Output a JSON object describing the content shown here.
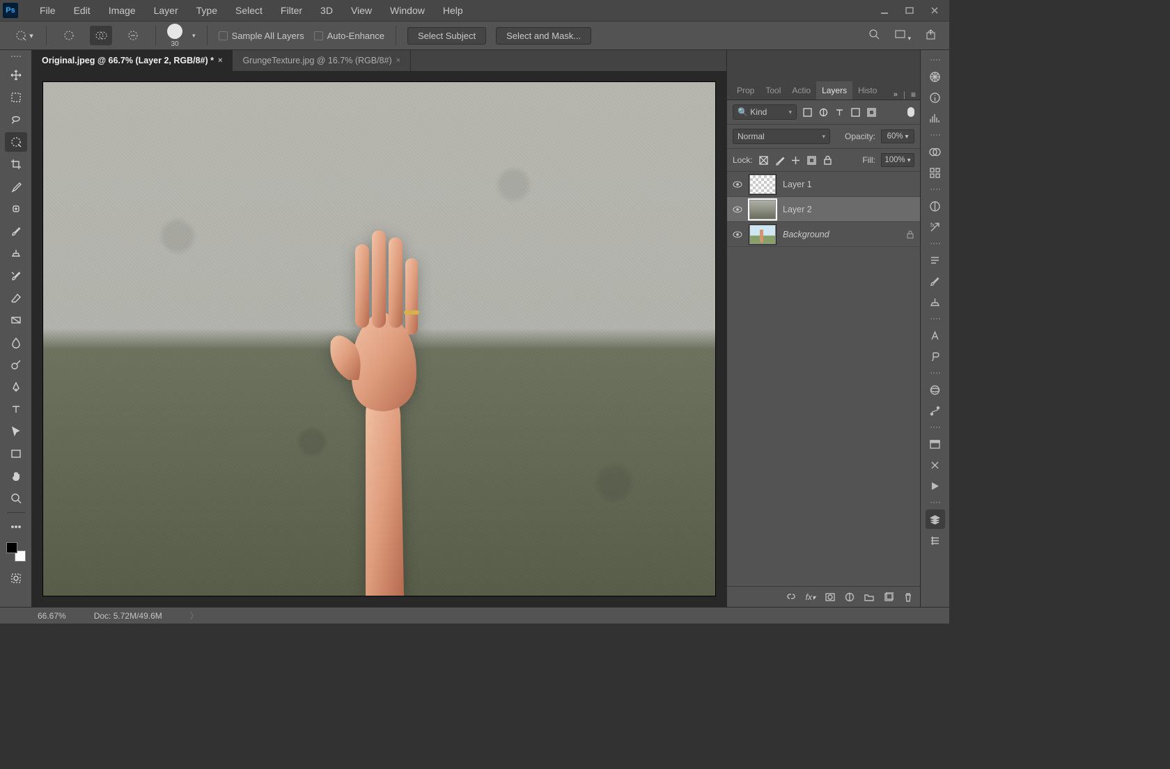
{
  "menu": [
    "File",
    "Edit",
    "Image",
    "Layer",
    "Type",
    "Select",
    "Filter",
    "3D",
    "View",
    "Window",
    "Help"
  ],
  "options": {
    "brush_size": "30",
    "sample_all": "Sample All Layers",
    "auto_enhance": "Auto-Enhance",
    "select_subject": "Select Subject",
    "select_mask": "Select and Mask..."
  },
  "doc_tabs": [
    {
      "label": "Original.jpeg @ 66.7% (Layer 2, RGB/8#) *",
      "active": true
    },
    {
      "label": "GrungeTexture.jpg @ 16.7% (RGB/8#)",
      "active": false
    }
  ],
  "panel": {
    "tabs": [
      "Prop",
      "Tool",
      "Actio",
      "Layers",
      "Histo"
    ],
    "active_tab": "Layers",
    "filter_kind": "Kind",
    "blend_mode": "Normal",
    "opacity_label": "Opacity:",
    "opacity_value": "60%",
    "lock_label": "Lock:",
    "fill_label": "Fill:",
    "fill_value": "100%",
    "layers": [
      {
        "name": "Layer 1",
        "thumb": "checker",
        "selected": false,
        "locked": false,
        "italic": false
      },
      {
        "name": "Layer 2",
        "thumb": "txbg",
        "selected": true,
        "locked": false,
        "italic": false
      },
      {
        "name": "Background",
        "thumb": "skybg",
        "selected": false,
        "locked": true,
        "italic": true
      }
    ]
  },
  "status": {
    "zoom": "66.67%",
    "doc": "Doc: 5.72M/49.6M"
  }
}
